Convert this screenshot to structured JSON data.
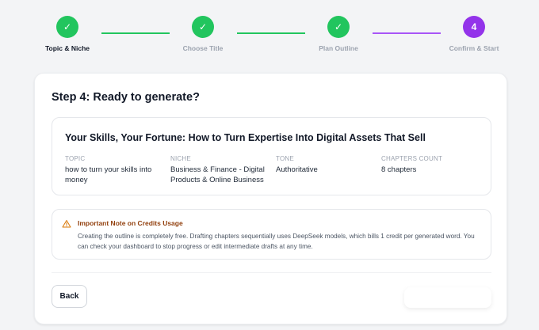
{
  "stepper": {
    "steps": [
      {
        "label": "Topic & Niche",
        "marker": "✓",
        "state": "done"
      },
      {
        "label": "Choose Title",
        "marker": "✓",
        "state": "done"
      },
      {
        "label": "Plan Outline",
        "marker": "✓",
        "state": "done"
      },
      {
        "label": "Confirm & Start",
        "marker": "4",
        "state": "current"
      }
    ]
  },
  "card": {
    "title": "Step 4: Ready to generate?",
    "summary": {
      "book_title": "Your Skills, Your Fortune: How to Turn Expertise Into Digital Assets That Sell",
      "fields": [
        {
          "key": "TOPIC",
          "value": "how to turn your skills into money"
        },
        {
          "key": "NICHE",
          "value": "Business & Finance - Digital Products & Online Business"
        },
        {
          "key": "TONE",
          "value": "Authoritative"
        },
        {
          "key": "CHAPTERS COUNT",
          "value": "8 chapters"
        }
      ]
    },
    "note": {
      "icon": "warning-triangle-icon",
      "title": "Important Note on Credits Usage",
      "body": "Creating the outline is completely free. Drafting chapters sequentially uses DeepSeek models, which bills 1 credit per generated word. You can check your dashboard to stop progress or edit intermediate drafts at any time."
    },
    "back_label": "Back",
    "start_label": ""
  },
  "colors": {
    "done": "#22c55e",
    "current": "#9333ea",
    "warning": "#d97706"
  }
}
